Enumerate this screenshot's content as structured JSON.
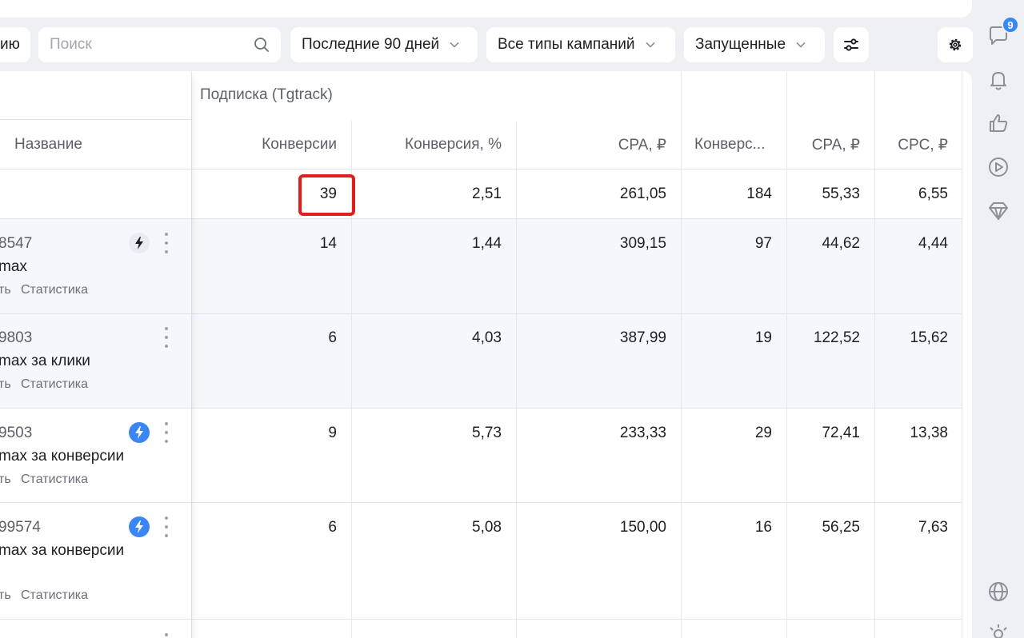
{
  "toolbar": {
    "cut_label": "ию",
    "search_placeholder": "Поиск",
    "period": "Последние 90 дней",
    "campaign_types": "Все типы кампаний",
    "status": "Запущенные"
  },
  "table": {
    "group_header": "Подписка (Tgtrack)",
    "columns": {
      "name": "Название",
      "conversions": "Конверсии",
      "conversion_rate": "Конверсия, %",
      "cpa": "CPA, ₽",
      "conversions2": "Конверс...",
      "cpa2": "CPA, ₽",
      "cpc": "CPC, ₽"
    },
    "total": {
      "conversions": "39",
      "conversion_rate": "2,51",
      "cpa": "261,05",
      "conversions2": "184",
      "cpa2": "55,33",
      "cpc": "6,55"
    },
    "rows": [
      {
        "id": "8547",
        "name": "max",
        "link_edit": "ть",
        "link_stats": "Статистика",
        "conversions": "14",
        "conversion_rate": "1,44",
        "cpa": "309,15",
        "conversions2": "97",
        "cpa2": "44,62",
        "cpc": "4,44"
      },
      {
        "id": "9803",
        "name": "max за клики",
        "link_edit": "ть",
        "link_stats": "Статистика",
        "conversions": "6",
        "conversion_rate": "4,03",
        "cpa": "387,99",
        "conversions2": "19",
        "cpa2": "122,52",
        "cpc": "15,62"
      },
      {
        "id": "9503",
        "name": "max за конверсии",
        "link_edit": "ть",
        "link_stats": "Статистика",
        "conversions": "9",
        "conversion_rate": "5,73",
        "cpa": "233,33",
        "conversions2": "29",
        "cpa2": "72,41",
        "cpc": "13,38"
      },
      {
        "id": "99574",
        "name": "max за конверсии",
        "link_edit": "ть",
        "link_stats": "Статистика",
        "conversions": "6",
        "conversion_rate": "5,08",
        "cpa": "150,00",
        "conversions2": "16",
        "cpa2": "56,25",
        "cpc": "7,63"
      }
    ]
  },
  "sidebar": {
    "chat_badge": "9",
    "icons": [
      "chat-icon",
      "bell-icon",
      "thumbs-up-icon",
      "play-icon",
      "diamond-icon",
      "globe-icon",
      "sun-icon"
    ]
  },
  "colors": {
    "accent": "#3a86f5",
    "highlight": "#e21d1d",
    "background": "#eef0f4"
  }
}
